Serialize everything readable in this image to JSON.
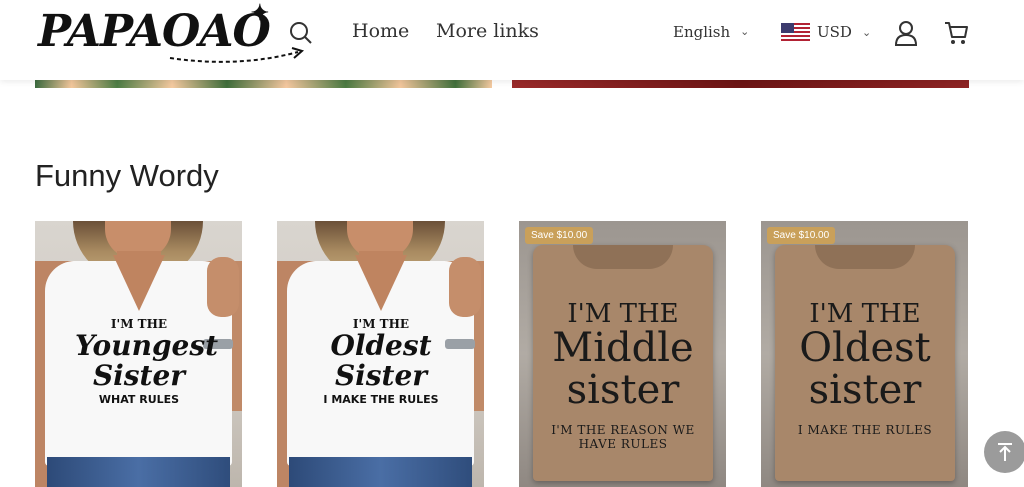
{
  "header": {
    "logo_text": "PAPAOAO",
    "nav": [
      {
        "label": "Home"
      },
      {
        "label": "More links"
      }
    ],
    "language": "English",
    "currency": "USD",
    "icons": [
      "search-icon",
      "chevron-down-icon",
      "us-flag-icon",
      "account-icon",
      "cart-icon"
    ]
  },
  "section": {
    "title": "Funny Wordy"
  },
  "products": [
    {
      "print_top": "I'M THE",
      "print_big_1": "Youngest",
      "print_big_2": "Sister",
      "print_small": "WHAT RULES",
      "badge": ""
    },
    {
      "print_top": "I'M THE",
      "print_big_1": "Oldest",
      "print_big_2": "Sister",
      "print_small": "I MAKE THE RULES",
      "badge": ""
    },
    {
      "line1": "I'M THE",
      "line2": "Middle",
      "line3": "sister",
      "line4": "I'M THE REASON WE HAVE RULES",
      "badge": "Save $10.00"
    },
    {
      "line1": "I'M THE",
      "line2": "Oldest",
      "line3": "sister",
      "line4": "I MAKE THE RULES",
      "badge": "Save $10.00"
    }
  ],
  "colors": {
    "badge": "#c9a05a",
    "back_to_top": "#9b9b9b"
  }
}
